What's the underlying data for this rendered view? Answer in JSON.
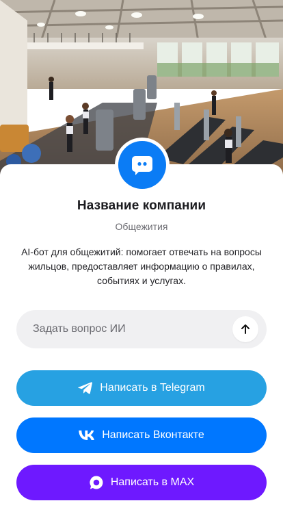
{
  "hero": {
    "icon": "gym-illustration"
  },
  "company": {
    "name": "Название компании",
    "category": "Общежития",
    "description": "AI-бот для общежитий: помогает отвечать на вопросы жильцов, предоставляет информацию о правилах, событиях и услугах.",
    "avatar_icon": "chat-bot-icon"
  },
  "ask": {
    "placeholder": "Задать вопрос ИИ",
    "send_icon": "arrow-up-icon"
  },
  "buttons": {
    "telegram": {
      "label": "Написать в Telegram",
      "icon": "telegram-icon",
      "color": "#27a1e2"
    },
    "vk": {
      "label": "Написать Вконтакте",
      "icon": "vk-icon",
      "color": "#0077ff"
    },
    "max": {
      "label": "Написать в MAX",
      "icon": "max-icon",
      "color": "#6e19ff"
    }
  },
  "colors": {
    "avatar": "#0b7cf5",
    "ask_background": "#f0f0f2"
  }
}
